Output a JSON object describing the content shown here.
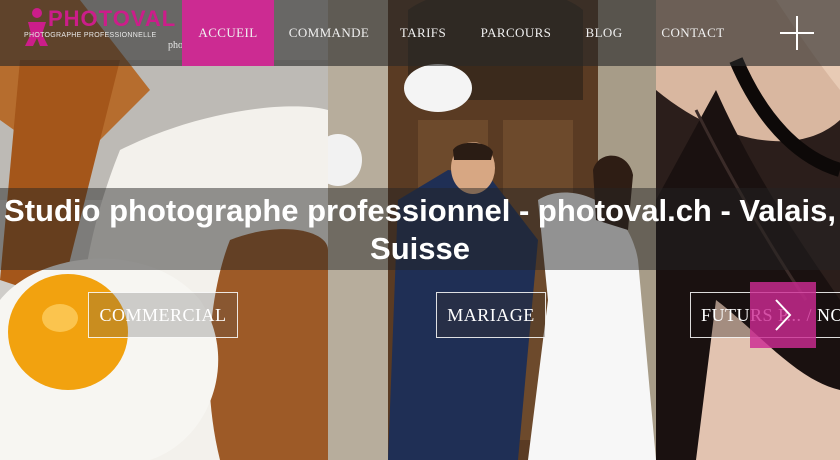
{
  "brand": {
    "logo_word": "PHOTOVAL",
    "logo_tagline": "PHOTOGRAPHE PROFESSIONNELLE",
    "domain": "photoval.ch",
    "accent_color": "#cc2b92"
  },
  "nav": {
    "items": [
      {
        "label": "ACCUEIL",
        "active": true
      },
      {
        "label": "COMMANDE",
        "active": false
      },
      {
        "label": "TARIFS",
        "active": false
      },
      {
        "label": "PARCOURS",
        "active": false
      },
      {
        "label": "BLOG",
        "active": false
      },
      {
        "label": "CONTACT",
        "active": false
      }
    ],
    "menu_icon": "plus-icon"
  },
  "hero": {
    "title": "Studio photographe professionnel - photoval.ch - Valais, Suisse"
  },
  "categories": [
    {
      "label": "COMMERCIAL"
    },
    {
      "label": "MARIAGE"
    },
    {
      "label": "FUTURS P... / NO"
    }
  ],
  "slider": {
    "next_icon": "chevron-right-icon"
  }
}
